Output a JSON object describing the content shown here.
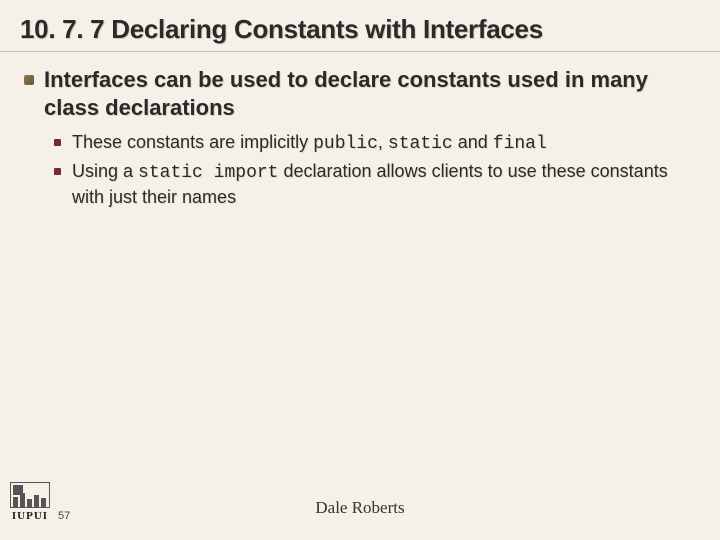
{
  "title": "10. 7. 7 Declaring Constants with Interfaces",
  "bullets": {
    "b1": "Interfaces can be used to declare constants used in many class declarations",
    "b2a_pre": "These constants are implicitly ",
    "b2a_code1": "public",
    "b2a_mid1": ", ",
    "b2a_code2": "static",
    "b2a_mid2": " and ",
    "b2a_code3": "final",
    "b2b_pre": "Using a ",
    "b2b_code1": "static import",
    "b2b_post": " declaration allows clients to use these constants with just their names"
  },
  "footer": {
    "logo_text": "IUPUI",
    "slide_number": "57",
    "author": "Dale Roberts"
  }
}
